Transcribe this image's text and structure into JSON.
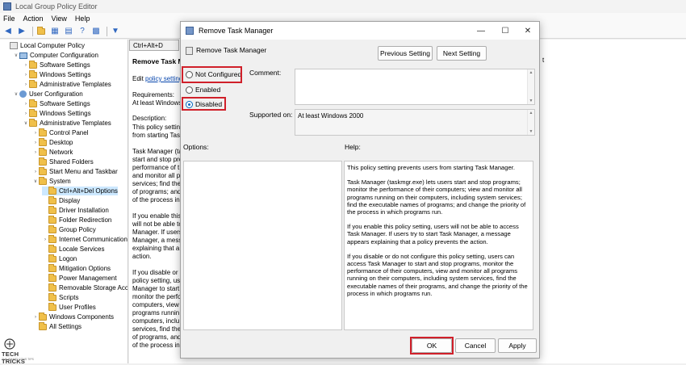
{
  "app": {
    "title": "Local Group Policy Editor",
    "menu": [
      "File",
      "Action",
      "View",
      "Help"
    ]
  },
  "tree": [
    {
      "label": "Local Computer Policy",
      "level": 0,
      "twisty": "",
      "icon": "gpo-icon"
    },
    {
      "label": "Computer Configuration",
      "level": 1,
      "twisty": "open",
      "icon": "computer-icon"
    },
    {
      "label": "Software Settings",
      "level": 2,
      "twisty": "closed",
      "icon": "folder-icon"
    },
    {
      "label": "Windows Settings",
      "level": 2,
      "twisty": "closed",
      "icon": "folder-icon"
    },
    {
      "label": "Administrative Templates",
      "level": 2,
      "twisty": "closed",
      "icon": "folder-icon"
    },
    {
      "label": "User Configuration",
      "level": 1,
      "twisty": "open",
      "icon": "user-icon"
    },
    {
      "label": "Software Settings",
      "level": 2,
      "twisty": "closed",
      "icon": "folder-icon"
    },
    {
      "label": "Windows Settings",
      "level": 2,
      "twisty": "closed",
      "icon": "folder-icon"
    },
    {
      "label": "Administrative Templates",
      "level": 2,
      "twisty": "open",
      "icon": "folder-icon"
    },
    {
      "label": "Control Panel",
      "level": 3,
      "twisty": "closed",
      "icon": "folder-icon"
    },
    {
      "label": "Desktop",
      "level": 3,
      "twisty": "closed",
      "icon": "folder-icon"
    },
    {
      "label": "Network",
      "level": 3,
      "twisty": "closed",
      "icon": "folder-icon"
    },
    {
      "label": "Shared Folders",
      "level": 3,
      "twisty": "",
      "icon": "folder-icon"
    },
    {
      "label": "Start Menu and Taskbar",
      "level": 3,
      "twisty": "closed",
      "icon": "folder-icon"
    },
    {
      "label": "System",
      "level": 3,
      "twisty": "open",
      "icon": "folder-icon"
    },
    {
      "label": "Ctrl+Alt+Del Options",
      "level": 4,
      "twisty": "",
      "icon": "folder-icon",
      "selected": true
    },
    {
      "label": "Display",
      "level": 4,
      "twisty": "",
      "icon": "folder-icon"
    },
    {
      "label": "Driver Installation",
      "level": 4,
      "twisty": "",
      "icon": "folder-icon"
    },
    {
      "label": "Folder Redirection",
      "level": 4,
      "twisty": "",
      "icon": "folder-icon"
    },
    {
      "label": "Group Policy",
      "level": 4,
      "twisty": "",
      "icon": "folder-icon"
    },
    {
      "label": "Internet Communication",
      "level": 4,
      "twisty": "closed",
      "icon": "folder-icon"
    },
    {
      "label": "Locale Services",
      "level": 4,
      "twisty": "",
      "icon": "folder-icon"
    },
    {
      "label": "Logon",
      "level": 4,
      "twisty": "",
      "icon": "folder-icon"
    },
    {
      "label": "Mitigation Options",
      "level": 4,
      "twisty": "",
      "icon": "folder-icon"
    },
    {
      "label": "Power Management",
      "level": 4,
      "twisty": "",
      "icon": "folder-icon"
    },
    {
      "label": "Removable Storage Acces",
      "level": 4,
      "twisty": "",
      "icon": "folder-icon"
    },
    {
      "label": "Scripts",
      "level": 4,
      "twisty": "",
      "icon": "folder-icon"
    },
    {
      "label": "User Profiles",
      "level": 4,
      "twisty": "",
      "icon": "folder-icon"
    },
    {
      "label": "Windows Components",
      "level": 3,
      "twisty": "closed",
      "icon": "folder-icon"
    },
    {
      "label": "All Settings",
      "level": 3,
      "twisty": "",
      "icon": "folder-icon"
    }
  ],
  "right_pane": {
    "tab": "Ctrl+Alt+D",
    "title": "Remove Task M",
    "edit_prefix": "Edit ",
    "edit_link": "policy setting",
    "requirements_label": "Requirements:",
    "requirements_value": "At least Windows",
    "description_label": "Description:",
    "desc_lines": [
      "This policy setting",
      "from starting Tas",
      "",
      "Task Manager (ta",
      "start and stop pro",
      "performance of t",
      "and monitor all p",
      "services; find the",
      "of programs; and",
      "of the process in",
      "",
      "If you enable this",
      "will not be able to",
      "Manager. If users",
      "Manager, a mess",
      "explaining that a",
      "action.",
      "",
      "If you disable or c",
      "policy setting, us",
      "Manager to  start",
      "monitor the perfo",
      "computers, view",
      "programs runnin",
      "computers, inclu",
      "services, find the",
      "of programs, and",
      "of the process in"
    ],
    "col_header": "t"
  },
  "dialog": {
    "title": "Remove Task Manager",
    "header_title": "Remove Task Manager",
    "prev_button": "Previous Setting",
    "next_button": "Next Setting",
    "radio_not_configured": "Not Configured",
    "radio_enabled": "Enabled",
    "radio_disabled": "Disabled",
    "comment_label": "Comment:",
    "supported_label": "Supported on:",
    "supported_value": "At least Windows 2000",
    "options_label": "Options:",
    "help_label": "Help:",
    "help_paragraphs": [
      "This policy setting prevents users from starting Task Manager.",
      "Task Manager (taskmgr.exe) lets users start and stop programs; monitor the performance of their computers; view and monitor all programs running on their computers, including system services; find the executable names of programs; and change the priority of the process in which programs run.",
      "If you enable this policy setting, users will not be able to access Task Manager. If users try to start Task Manager, a message appears explaining that a policy prevents the action.",
      "If you disable or do not configure this policy setting, users can access Task Manager to  start and stop programs, monitor the performance of their computers, view and monitor all programs running on their computers, including system services, find the executable names of their programs, and change the priority of the process in which programs run."
    ],
    "ok_button": "OK",
    "cancel_button": "Cancel",
    "apply_button": "Apply"
  },
  "watermark": {
    "text": "TECH TRICKS",
    "sub": "THE SMART CONS TIPS"
  },
  "colors": {
    "highlight": "#d0202a",
    "selection": "#cce8ff",
    "link": "#0645ad",
    "accent": "#0067c0"
  }
}
